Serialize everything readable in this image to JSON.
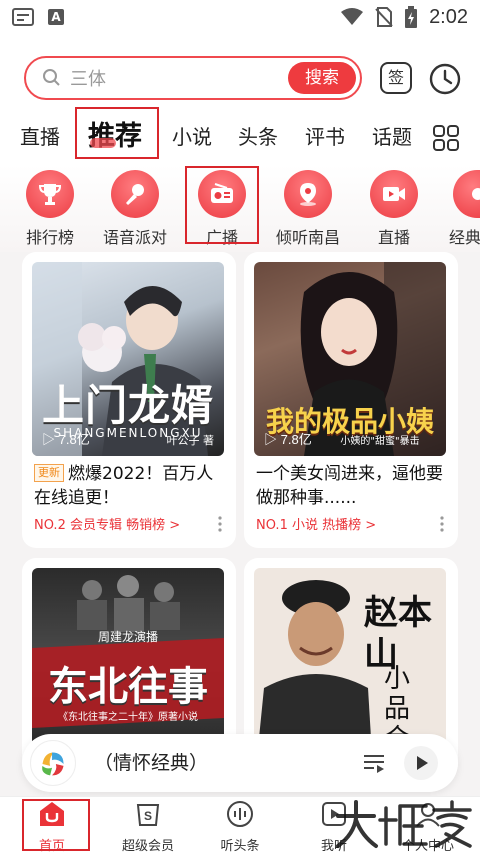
{
  "status_bar": {
    "time": "2:02",
    "notification_letter": "A"
  },
  "search": {
    "placeholder": "三体",
    "button": "搜索"
  },
  "header_buttons": {
    "sign": "签"
  },
  "tabs": [
    {
      "label": "直播"
    },
    {
      "label": "推荐",
      "active": true
    },
    {
      "label": "小说"
    },
    {
      "label": "头条"
    },
    {
      "label": "评书"
    },
    {
      "label": "话题"
    }
  ],
  "categories": [
    {
      "label": "排行榜",
      "icon": "trophy-icon"
    },
    {
      "label": "语音派对",
      "icon": "microphone-icon"
    },
    {
      "label": "广播",
      "icon": "radio-icon"
    },
    {
      "label": "倾听南昌",
      "icon": "location-pin-icon"
    },
    {
      "label": "直播",
      "icon": "video-icon"
    },
    {
      "label": "经典",
      "icon": "classic-icon"
    }
  ],
  "cards": [
    {
      "cover_title": "上门龙婿",
      "cover_subtitle": "SHANGMENLONGXU",
      "cover_author": "叶公子 著",
      "plays": "7.8亿",
      "badge": "更新",
      "title": "燃爆2022！百万人在线追更！",
      "rank": "NO.2 会员专辑 畅销榜 >"
    },
    {
      "cover_title": "我的极品小姨",
      "cover_subtitle": "小姨的\"甜蜜\"暴击",
      "plays": "7.8亿",
      "title": "一个美女闯进来，逼他要做那种事......",
      "rank": "NO.1 小说 热播榜 >"
    },
    {
      "cover_top": "周建龙演播",
      "cover_title": "东北往事",
      "cover_subtitle": "《东北往事之二十年》原著小说"
    },
    {
      "cover_title": "赵本山",
      "cover_subtitle": "小品合集"
    }
  ],
  "player": {
    "title": "（情怀经典）"
  },
  "navbar": [
    {
      "label": "首页",
      "active": true
    },
    {
      "label": "超级会员"
    },
    {
      "label": "听头条"
    },
    {
      "label": "我听"
    },
    {
      "label": "个人中心"
    }
  ],
  "colors": {
    "accent": "#ee3b3f",
    "highlight_box": "#d9262c",
    "rank_text": "#ea3338"
  }
}
